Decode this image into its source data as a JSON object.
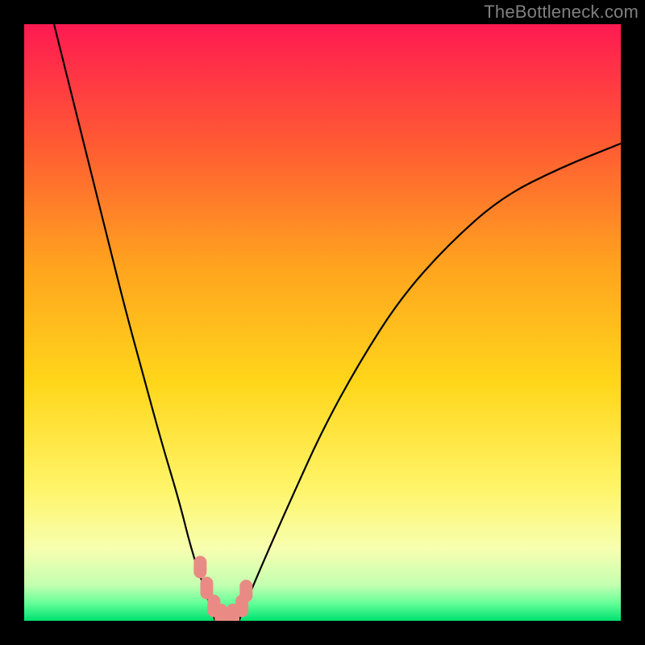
{
  "watermark": "TheBottleneck.com",
  "chart_data": {
    "type": "line",
    "title": "",
    "xlabel": "",
    "ylabel": "",
    "xlim": [
      0,
      100
    ],
    "ylim": [
      0,
      100
    ],
    "grid": false,
    "legend": false,
    "background_gradient": {
      "stops": [
        {
          "offset": 0.0,
          "color": "#ff1a52"
        },
        {
          "offset": 0.2,
          "color": "#ff5a33"
        },
        {
          "offset": 0.4,
          "color": "#ffa21f"
        },
        {
          "offset": 0.6,
          "color": "#ffd61a"
        },
        {
          "offset": 0.78,
          "color": "#fff56a"
        },
        {
          "offset": 0.88,
          "color": "#f7ffb0"
        },
        {
          "offset": 0.94,
          "color": "#c4ffb0"
        },
        {
          "offset": 0.97,
          "color": "#66ff99"
        },
        {
          "offset": 1.0,
          "color": "#00e070"
        }
      ]
    },
    "series": [
      {
        "name": "left-curve",
        "x": [
          5,
          8,
          11,
          14,
          17,
          20,
          23,
          26,
          28,
          30,
          31,
          32
        ],
        "y": [
          100,
          88,
          76,
          64,
          52,
          41,
          30,
          20,
          12,
          6,
          3,
          0
        ]
      },
      {
        "name": "right-curve",
        "x": [
          36,
          38,
          41,
          45,
          50,
          56,
          63,
          71,
          80,
          90,
          100
        ],
        "y": [
          0,
          5,
          12,
          21,
          32,
          43,
          54,
          63,
          71,
          76,
          80
        ]
      }
    ],
    "marker_cluster": {
      "comment": "salmon rounded rectangles near the curve minimum",
      "points": [
        {
          "x": 29.5,
          "y": 9.0
        },
        {
          "x": 30.6,
          "y": 5.5
        },
        {
          "x": 31.8,
          "y": 2.5
        },
        {
          "x": 33.0,
          "y": 1.0
        },
        {
          "x": 35.0,
          "y": 1.0
        },
        {
          "x": 36.5,
          "y": 2.5
        },
        {
          "x": 37.2,
          "y": 5.0
        }
      ],
      "color": "#e98b84"
    }
  }
}
